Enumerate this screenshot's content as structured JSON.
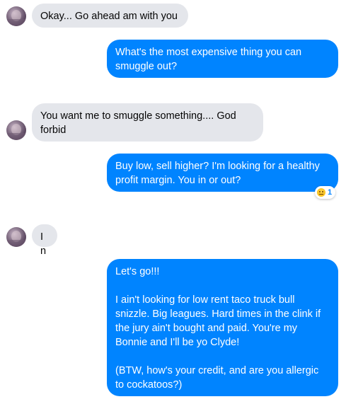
{
  "messages": [
    {
      "sender": "them",
      "text": "Okay... Go ahead am with you"
    },
    {
      "sender": "me",
      "text": "What's the most expensive thing you can smuggle out?"
    },
    {
      "sender": "them",
      "text": "You want me to smuggle something.... God forbid"
    },
    {
      "sender": "me",
      "text": "Buy low, sell higher? I'm looking for a healthy profit margin. You in or out?",
      "reaction": {
        "emoji": "grimacing-face-icon",
        "count": "1"
      }
    },
    {
      "sender": "them",
      "text": "In"
    },
    {
      "sender": "me",
      "text": "Let's go!!!\n\nI ain't looking for low rent taco truck bull snizzle. Big leagues. Hard times in the clink if the jury ain't bought and paid. You're my Bonnie and I'll be yo Clyde!\n\n(BTW, how's your credit, and are you allergic to cockatoos?)"
    }
  ],
  "colors": {
    "incoming_bubble": "#e4e6eb",
    "outgoing_bubble": "#0084ff",
    "background": "#ffffff"
  }
}
